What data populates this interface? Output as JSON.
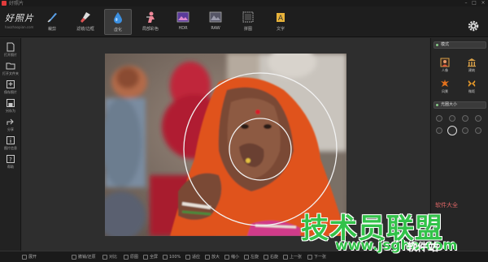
{
  "window": {
    "title": "好照片"
  },
  "app": {
    "brand": "好照片",
    "subtitle": "haozhaopian.com"
  },
  "toolbar": {
    "tools": [
      {
        "id": "crop",
        "label": "裁剪",
        "icon": "knife-icon",
        "active": false
      },
      {
        "id": "brush",
        "label": "滤镜/边框",
        "icon": "brush-icon",
        "active": false
      },
      {
        "id": "blur",
        "label": "虚化",
        "icon": "water-drop-icon",
        "active": true
      },
      {
        "id": "color",
        "label": "局部彩色",
        "icon": "figure-icon",
        "active": false
      },
      {
        "id": "hdr",
        "label": "HDR",
        "icon": "hdr-icon",
        "active": false
      },
      {
        "id": "raw",
        "label": "RAW",
        "icon": "raw-icon",
        "active": false
      },
      {
        "id": "frame",
        "label": "拼图",
        "icon": "frame-icon",
        "active": false
      },
      {
        "id": "text",
        "label": "文字",
        "icon": "text-icon",
        "active": false
      }
    ]
  },
  "sidebar": {
    "items": [
      {
        "label": "打开照片",
        "icon": "open-file-icon"
      },
      {
        "label": "打开文件夹",
        "icon": "folder-icon"
      },
      {
        "label": "保存照片",
        "icon": "save-icon"
      },
      {
        "label": "另存为",
        "icon": "save-as-icon"
      },
      {
        "label": "分享",
        "icon": "share-icon"
      },
      {
        "label": "图片信息",
        "icon": "info-icon"
      },
      {
        "label": "帮助",
        "icon": "help-icon"
      }
    ]
  },
  "right_panel": {
    "mode_title": "模式",
    "modes": [
      {
        "label": "人像",
        "icon": "portrait-icon"
      },
      {
        "label": "建筑",
        "icon": "building-icon"
      },
      {
        "label": "风景",
        "icon": "landscape-icon"
      },
      {
        "label": "微距",
        "icon": "macro-icon"
      }
    ],
    "aperture_title": "光圈大小"
  },
  "statusbar": {
    "items": [
      {
        "label": "展开",
        "icon": "expand-icon"
      },
      {
        "label": "撤销/还原",
        "icon": "undo-icon"
      },
      {
        "label": "对比",
        "icon": "compare-icon"
      },
      {
        "label": "原图",
        "icon": "original-icon"
      },
      {
        "label": "全屏",
        "icon": "fullscreen-icon"
      },
      {
        "label": "100%",
        "icon": "zoom-icon"
      },
      {
        "label": "适应",
        "icon": "fit-icon"
      },
      {
        "label": "放大",
        "icon": "zoom-in-icon"
      },
      {
        "label": "缩小",
        "icon": "zoom-out-icon"
      },
      {
        "label": "左旋",
        "icon": "rotate-left-icon"
      },
      {
        "label": "右旋",
        "icon": "rotate-right-icon"
      },
      {
        "label": "上一张",
        "icon": "prev-icon"
      },
      {
        "label": "下一张",
        "icon": "next-icon"
      }
    ]
  },
  "watermark": {
    "main": "技术员联盟",
    "url": "www.jsgho.com",
    "tail": "软件站",
    "small": "软件大全"
  },
  "colors": {
    "accent": "#33c24a",
    "toolbar_bg": "#1e1e1e",
    "canvas_bg": "#2e2e2e"
  }
}
